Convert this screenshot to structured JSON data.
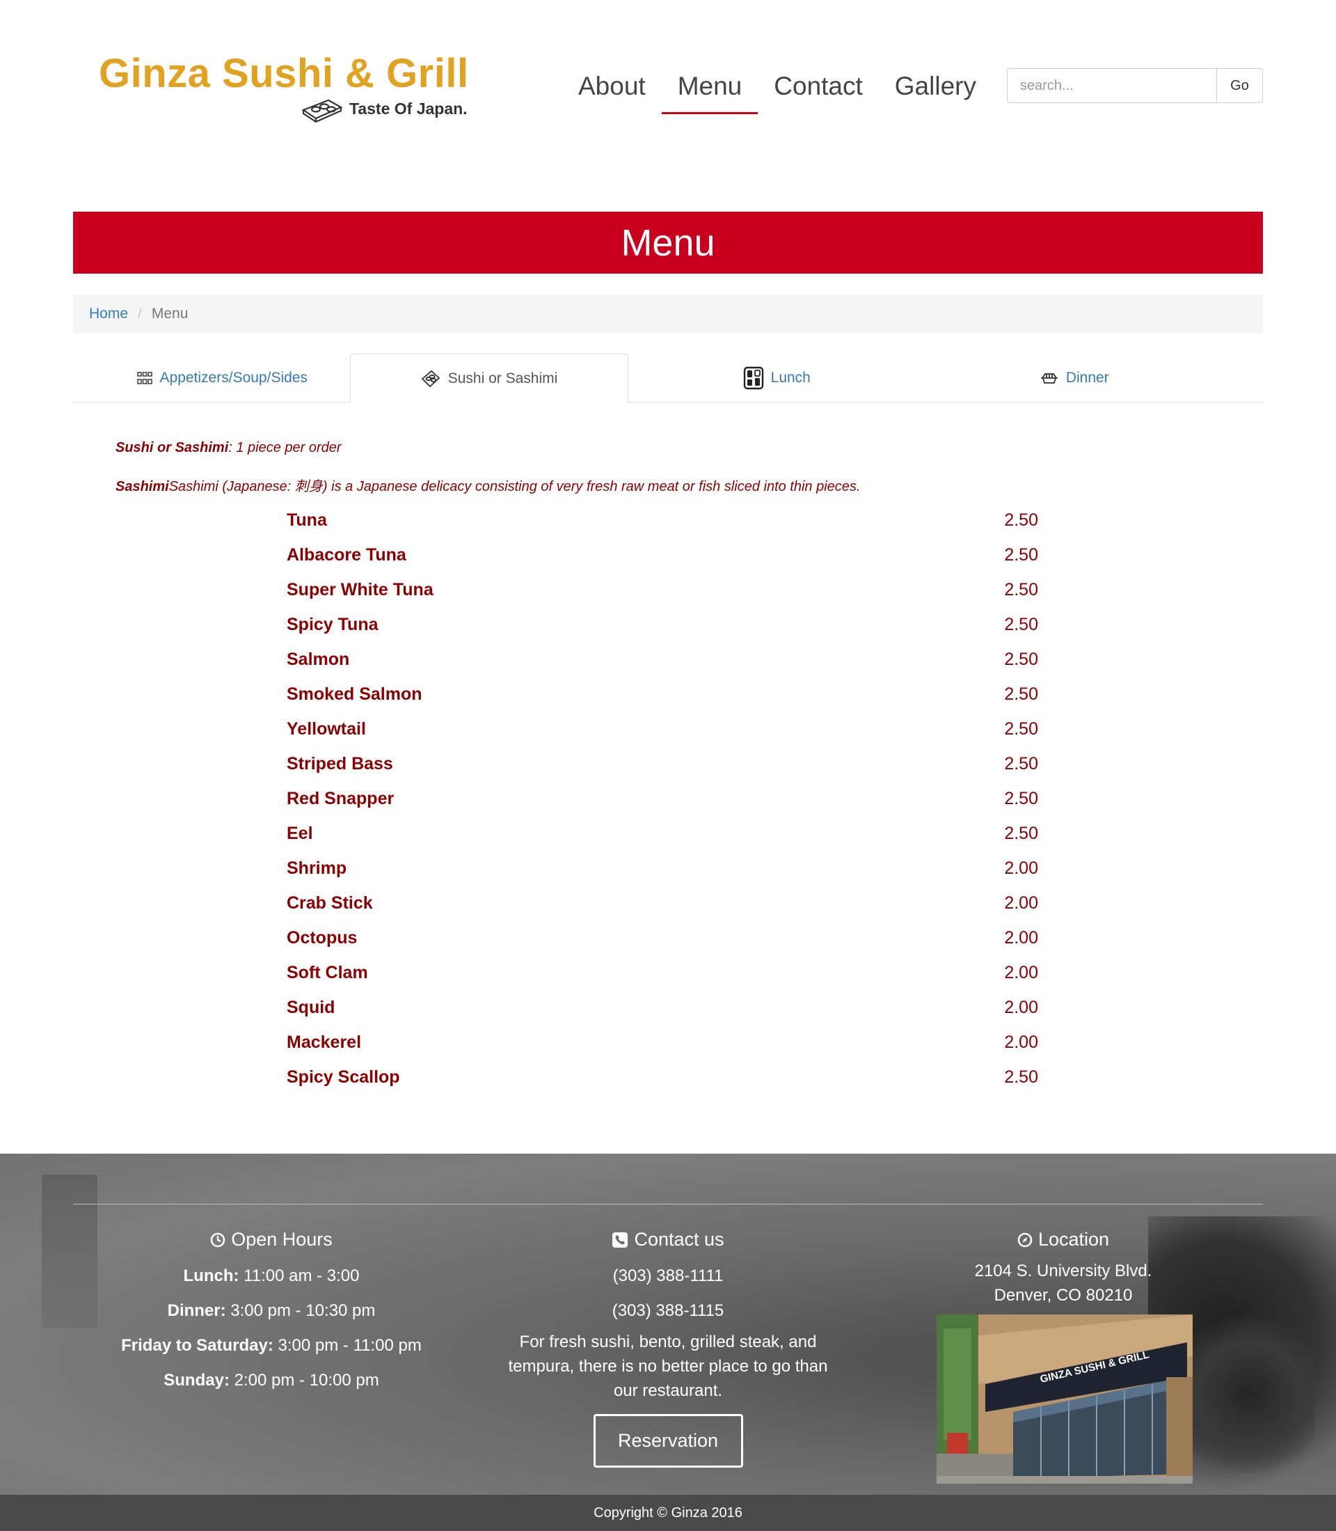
{
  "brand": {
    "name": "Ginza Sushi & Grill",
    "tagline": "Taste Of Japan.",
    "primary_color": "#c8001e",
    "logo_color": "#e0a21f",
    "item_color": "#8b0000"
  },
  "nav": {
    "items": [
      {
        "label": "About",
        "active": false
      },
      {
        "label": "Menu",
        "active": true
      },
      {
        "label": "Contact",
        "active": false
      },
      {
        "label": "Gallery",
        "active": false
      }
    ]
  },
  "search": {
    "placeholder": "search...",
    "button": "Go"
  },
  "page_title": "Menu",
  "breadcrumb": {
    "home": "Home",
    "current": "Menu"
  },
  "tabs": [
    {
      "label": "Appetizers/Soup/Sides",
      "icon": "bowls-icon",
      "active": false
    },
    {
      "label": "Sushi or Sashimi",
      "icon": "sushi-icon",
      "active": true
    },
    {
      "label": "Lunch",
      "icon": "bento-icon",
      "active": false
    },
    {
      "label": "Dinner",
      "icon": "grill-icon",
      "active": false
    }
  ],
  "intro": {
    "line1_bold": "Sushi or Sashimi",
    "line1_rest": ": 1 piece per order",
    "line2_bold": "Sashimi",
    "line2_rest": "Sashimi (Japanese: 刺身) is a Japanese delicacy consisting of very fresh raw meat or fish sliced into thin pieces."
  },
  "menu_items": [
    {
      "name": "Tuna",
      "price": "2.50"
    },
    {
      "name": "Albacore Tuna",
      "price": "2.50"
    },
    {
      "name": "Super White Tuna",
      "price": "2.50"
    },
    {
      "name": "Spicy Tuna",
      "price": "2.50"
    },
    {
      "name": "Salmon",
      "price": "2.50"
    },
    {
      "name": "Smoked Salmon",
      "price": "2.50"
    },
    {
      "name": "Yellowtail",
      "price": "2.50"
    },
    {
      "name": "Striped Bass",
      "price": "2.50"
    },
    {
      "name": "Red Snapper",
      "price": "2.50"
    },
    {
      "name": "Eel",
      "price": "2.50"
    },
    {
      "name": "Shrimp",
      "price": "2.00"
    },
    {
      "name": "Crab Stick",
      "price": "2.00"
    },
    {
      "name": "Octopus",
      "price": "2.00"
    },
    {
      "name": "Soft Clam",
      "price": "2.00"
    },
    {
      "name": "Squid",
      "price": "2.00"
    },
    {
      "name": "Mackerel",
      "price": "2.00"
    },
    {
      "name": "Spicy Scallop",
      "price": "2.50"
    }
  ],
  "footer": {
    "hours": {
      "title": "Open Hours",
      "rows": [
        {
          "label": "Lunch:",
          "value": " 11:00 am - 3:00"
        },
        {
          "label": "Dinner:",
          "value": " 3:00 pm - 10:30 pm"
        },
        {
          "label": "Friday to Saturday:",
          "value": " 3:00 pm - 11:00 pm"
        },
        {
          "label": "Sunday:",
          "value": " 2:00 pm - 10:00 pm"
        }
      ]
    },
    "contact": {
      "title": "Contact us",
      "phone1": "(303) 388-1111",
      "phone2": "(303) 388-1115",
      "description": "For fresh sushi, bento, grilled steak, and tempura, there is no better place to go than our restaurant.",
      "button": "Reservation"
    },
    "location": {
      "title": "Location",
      "address1": "2104 S. University Blvd.",
      "address2": "Denver, CO 80210",
      "storefront_sign": "GINZA SUSHI & GRILL"
    },
    "copyright": "Copyright © Ginza 2016"
  }
}
